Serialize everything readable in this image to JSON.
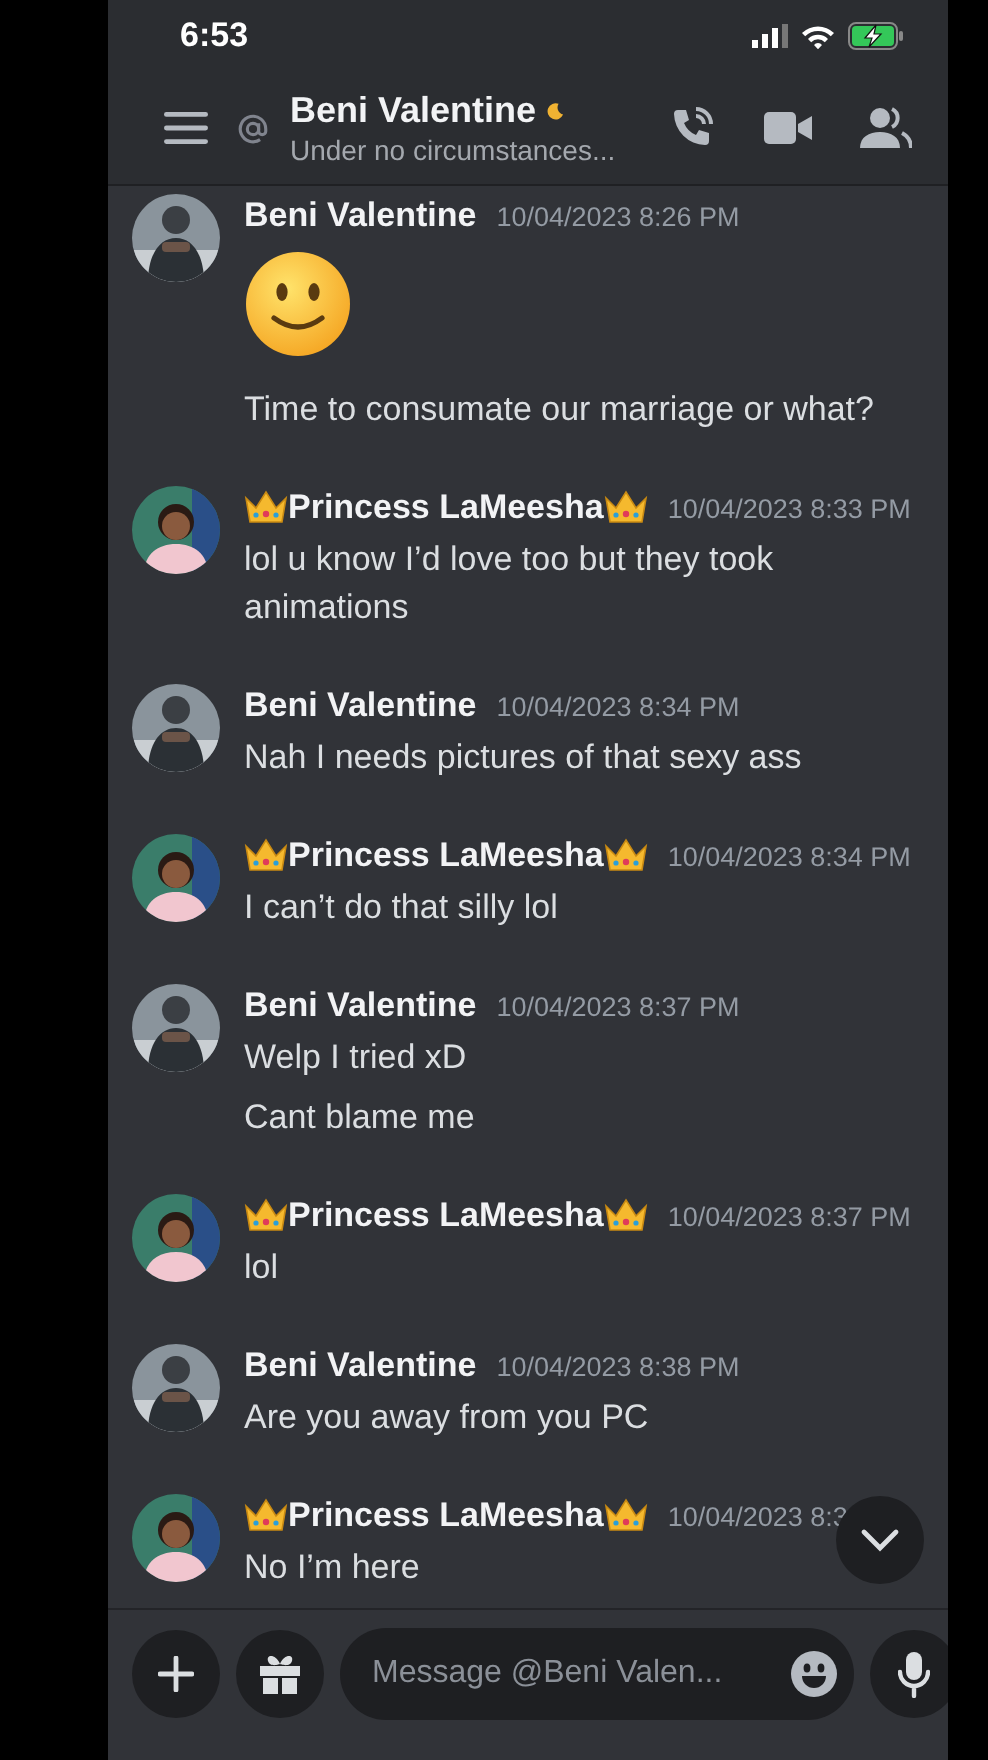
{
  "status_bar": {
    "time": "6:53",
    "charging": true
  },
  "header": {
    "name": "Beni Valentine",
    "idle": true,
    "subtitle": "Under no circumstances..."
  },
  "messages": [
    {
      "author": "Beni Valentine",
      "kind": "beni",
      "crowned": false,
      "time": "10/04/2023 8:26 PM",
      "content": [
        {
          "kind": "emoji"
        },
        {
          "kind": "text",
          "text": "Time to consumate our marriage or what?"
        }
      ]
    },
    {
      "author": "Princess LaMeesha",
      "kind": "princess",
      "crowned": true,
      "time": "10/04/2023 8:33 PM",
      "content": [
        {
          "kind": "text",
          "text": "lol u know I’d love too but they took animations"
        }
      ]
    },
    {
      "author": "Beni Valentine",
      "kind": "beni",
      "crowned": false,
      "time": "10/04/2023 8:34 PM",
      "content": [
        {
          "kind": "text",
          "text": "Nah I needs pictures of that sexy ass"
        }
      ]
    },
    {
      "author": "Princess LaMeesha",
      "kind": "princess",
      "crowned": true,
      "time": "10/04/2023 8:34 PM",
      "content": [
        {
          "kind": "text",
          "text": "I can’t do that silly lol"
        }
      ]
    },
    {
      "author": "Beni Valentine",
      "kind": "beni",
      "crowned": false,
      "time": "10/04/2023 8:37 PM",
      "content": [
        {
          "kind": "text",
          "text": "Welp I tried xD"
        },
        {
          "kind": "text",
          "text": "Cant blame me"
        }
      ]
    },
    {
      "author": "Princess LaMeesha",
      "kind": "princess",
      "crowned": true,
      "time": "10/04/2023 8:37 PM",
      "content": [
        {
          "kind": "text",
          "text": "lol"
        }
      ]
    },
    {
      "author": "Beni Valentine",
      "kind": "beni",
      "crowned": false,
      "time": "10/04/2023 8:38 PM",
      "content": [
        {
          "kind": "text",
          "text": "Are you away from you PC"
        }
      ]
    },
    {
      "author": "Princess LaMeesha",
      "kind": "princess",
      "crowned": true,
      "time": "10/04/2023 8:3",
      "content": [
        {
          "kind": "text",
          "text": "No I’m here"
        }
      ]
    }
  ],
  "composer": {
    "placeholder": "Message @Beni Valen..."
  }
}
